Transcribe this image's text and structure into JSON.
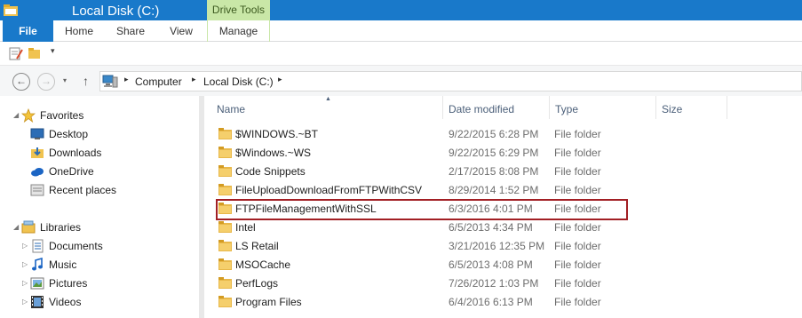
{
  "window": {
    "title": "Local Disk (C:)",
    "contextual_tab_group": "Drive Tools"
  },
  "ribbon": {
    "tabs": [
      {
        "label": "File"
      },
      {
        "label": "Home"
      },
      {
        "label": "Share"
      },
      {
        "label": "View"
      },
      {
        "label": "Manage"
      }
    ]
  },
  "qat": {
    "dropdown_glyph": "▾"
  },
  "address": {
    "crumbs": [
      {
        "label": "Computer"
      },
      {
        "label": "Local Disk (C:)"
      }
    ],
    "separator": "▸"
  },
  "nav_buttons": {
    "back": "←",
    "forward": "→",
    "recent": "▾",
    "up": "↑"
  },
  "nav_pane": {
    "favorites": {
      "label": "Favorites",
      "items": [
        {
          "label": "Desktop"
        },
        {
          "label": "Downloads"
        },
        {
          "label": "OneDrive"
        },
        {
          "label": "Recent places"
        }
      ]
    },
    "libraries": {
      "label": "Libraries",
      "items": [
        {
          "label": "Documents"
        },
        {
          "label": "Music"
        },
        {
          "label": "Pictures"
        },
        {
          "label": "Videos"
        }
      ]
    }
  },
  "columns": {
    "name": "Name",
    "date": "Date modified",
    "type": "Type",
    "size": "Size"
  },
  "files": [
    {
      "name": "$WINDOWS.~BT",
      "date": "9/22/2015 6:28 PM",
      "type": "File folder"
    },
    {
      "name": "$Windows.~WS",
      "date": "9/22/2015 6:29 PM",
      "type": "File folder"
    },
    {
      "name": "Code Snippets",
      "date": "2/17/2015 8:08 PM",
      "type": "File folder"
    },
    {
      "name": "FileUploadDownloadFromFTPWithCSV",
      "date": "8/29/2014 1:52 PM",
      "type": "File folder"
    },
    {
      "name": "FTPFileManagementWithSSL",
      "date": "6/3/2016 4:01 PM",
      "type": "File folder"
    },
    {
      "name": "Intel",
      "date": "6/5/2013 4:34 PM",
      "type": "File folder"
    },
    {
      "name": "LS Retail",
      "date": "3/21/2016 12:35 PM",
      "type": "File folder"
    },
    {
      "name": "MSOCache",
      "date": "6/5/2013 4:08 PM",
      "type": "File folder"
    },
    {
      "name": "PerfLogs",
      "date": "7/26/2012 1:03 PM",
      "type": "File folder"
    },
    {
      "name": "Program Files",
      "date": "6/4/2016 6:13 PM",
      "type": "File folder"
    }
  ],
  "colors": {
    "accent": "#1979ca",
    "context_tab": "#c9e7a7",
    "highlight_border": "#a21f24",
    "folder": "#e8b84a"
  }
}
